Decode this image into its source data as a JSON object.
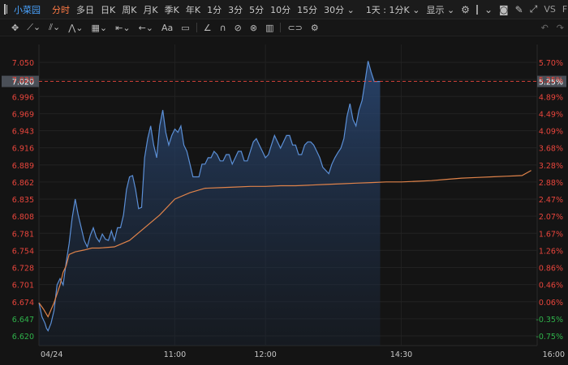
{
  "topbar": {
    "stock_name": "小菜园",
    "periods": [
      "分时",
      "多日",
      "日K",
      "周K",
      "月K",
      "季K",
      "年K",
      "1分",
      "3分",
      "5分",
      "10分",
      "15分"
    ],
    "active_period": "分时",
    "more_minutes": "30分",
    "multi_view": "1天 : 1分K",
    "display": "显示",
    "vs_label": "VS",
    "f10_label": "F10"
  },
  "toolbar": {
    "aa_label": "Aa"
  },
  "chart_data": {
    "type": "line",
    "ref_price": 6.67,
    "current_price": 7.02,
    "ylim": [
      6.61,
      7.07
    ],
    "left_ticks": [
      "7.050",
      "7.020",
      "6.996",
      "6.969",
      "6.943",
      "6.916",
      "6.889",
      "6.862",
      "6.835",
      "6.808",
      "6.781",
      "6.754",
      "6.728",
      "6.701",
      "6.674",
      "6.647",
      "6.620"
    ],
    "right_ticks": [
      "5.70%",
      "5.25%",
      "4.89%",
      "4.49%",
      "4.09%",
      "3.68%",
      "3.28%",
      "2.88%",
      "2.47%",
      "2.07%",
      "1.67%",
      "1.26%",
      "0.86%",
      "0.46%",
      "0.06%",
      "-0.35%",
      "-0.75%"
    ],
    "x_ticks": [
      "04/24",
      "11:00",
      "12:00",
      "14:30",
      "16:00"
    ],
    "price_label": "7.020",
    "pct_label": "5.25%",
    "series": [
      {
        "x": [
          0,
          2,
          4,
          5,
          6,
          8,
          10,
          12,
          14,
          16,
          18,
          20,
          22,
          24,
          26,
          28,
          30,
          32,
          34,
          36,
          38,
          40,
          42,
          44,
          46,
          48,
          50,
          52,
          54,
          56,
          58,
          60,
          62,
          64,
          66,
          68,
          70,
          72,
          74,
          76,
          78,
          80,
          82,
          84,
          86,
          88,
          90,
          92,
          94,
          96,
          98,
          100,
          102,
          104,
          106,
          108,
          110,
          112,
          114,
          116,
          118,
          120,
          122,
          124,
          126,
          128,
          130,
          132,
          134,
          136,
          138,
          140,
          142,
          144,
          146,
          148,
          150,
          152,
          154,
          156,
          158,
          160,
          162,
          164,
          166,
          168,
          170,
          172,
          174,
          176,
          178,
          180,
          182,
          184,
          186,
          188,
          190,
          192,
          194,
          196,
          198,
          200,
          202,
          204,
          206,
          208,
          210,
          212,
          214,
          216,
          218,
          220,
          222,
          224,
          226,
          228,
          230,
          232,
          234,
          236,
          238,
          240,
          242,
          244,
          246,
          248,
          250,
          252,
          254,
          256,
          258,
          260,
          262,
          264,
          266,
          268,
          270,
          272,
          274,
          276,
          278,
          280,
          282,
          284,
          286,
          288,
          290,
          292,
          294,
          296,
          298,
          300,
          302,
          304,
          306,
          308,
          310,
          312,
          314,
          316,
          318,
          320,
          322,
          324,
          326
        ],
        "values": [
          6.672,
          6.65,
          6.64,
          6.632,
          6.628,
          6.64,
          6.66,
          6.7,
          6.71,
          6.7,
          6.735,
          6.765,
          6.805,
          6.835,
          6.81,
          6.79,
          6.77,
          6.76,
          6.778,
          6.79,
          6.775,
          6.768,
          6.78,
          6.772,
          6.77,
          6.785,
          6.77,
          6.79,
          6.79,
          6.81,
          6.85,
          6.87,
          6.872,
          6.85,
          6.82,
          6.822,
          6.9,
          6.93,
          6.95,
          6.92,
          6.9,
          6.95,
          6.975,
          6.94,
          6.92,
          6.935,
          6.945,
          6.94,
          6.95,
          6.92,
          6.91,
          6.89,
          6.87,
          6.87,
          6.87,
          6.89,
          6.89,
          6.9,
          6.9,
          6.91,
          6.905,
          6.895,
          6.895,
          6.905,
          6.905,
          6.89,
          6.9,
          6.91,
          6.91,
          6.895,
          6.895,
          6.91,
          6.925,
          6.93,
          6.92,
          6.91,
          6.9,
          6.905,
          6.92,
          6.935,
          6.925,
          6.915,
          6.925,
          6.935,
          6.935,
          6.92,
          6.92,
          6.905,
          6.905,
          6.92,
          6.925,
          6.925,
          6.92,
          6.91,
          6.9,
          6.885,
          6.88,
          6.875,
          6.89,
          6.9,
          6.908,
          6.915,
          6.93,
          6.965,
          6.985,
          6.96,
          6.95,
          6.975,
          6.99,
          7.02,
          7.052,
          7.035,
          7.02,
          7.02,
          7.02,
          7.02,
          7.02,
          7.02,
          7.02,
          7.02,
          7.02,
          7.02,
          7.02,
          7.02,
          7.02,
          7.02,
          7.02,
          7.02,
          7.02,
          7.02,
          7.02,
          7.02,
          7.02,
          7.02,
          7.02,
          7.02,
          7.02,
          7.02,
          7.02,
          7.02,
          7.02,
          7.02,
          7.02,
          7.02,
          7.02,
          7.02,
          7.02,
          7.02,
          7.02,
          7.02,
          7.02,
          7.02,
          7.02,
          7.02,
          7.02,
          7.02,
          7.02,
          7.02,
          7.02,
          7.02,
          7.02,
          7.02,
          7.02,
          7.02,
          7.02
        ]
      },
      {
        "x": [
          0,
          3,
          6,
          10,
          14,
          16,
          18,
          20,
          24,
          30,
          35,
          40,
          50,
          60,
          70,
          80,
          90,
          100,
          110,
          120,
          130,
          140,
          150,
          160,
          170,
          180,
          190,
          200,
          210,
          220,
          230,
          240,
          250,
          260,
          270,
          280,
          290,
          300,
          310,
          320,
          326
        ],
        "values": [
          6.672,
          6.662,
          6.65,
          6.672,
          6.7,
          6.72,
          6.73,
          6.748,
          6.752,
          6.755,
          6.758,
          6.758,
          6.76,
          6.77,
          6.79,
          6.81,
          6.835,
          6.845,
          6.852,
          6.853,
          6.854,
          6.855,
          6.855,
          6.856,
          6.856,
          6.857,
          6.858,
          6.859,
          6.86,
          6.861,
          6.862,
          6.862,
          6.863,
          6.864,
          6.866,
          6.868,
          6.869,
          6.87,
          6.871,
          6.872,
          6.88
        ]
      }
    ]
  }
}
